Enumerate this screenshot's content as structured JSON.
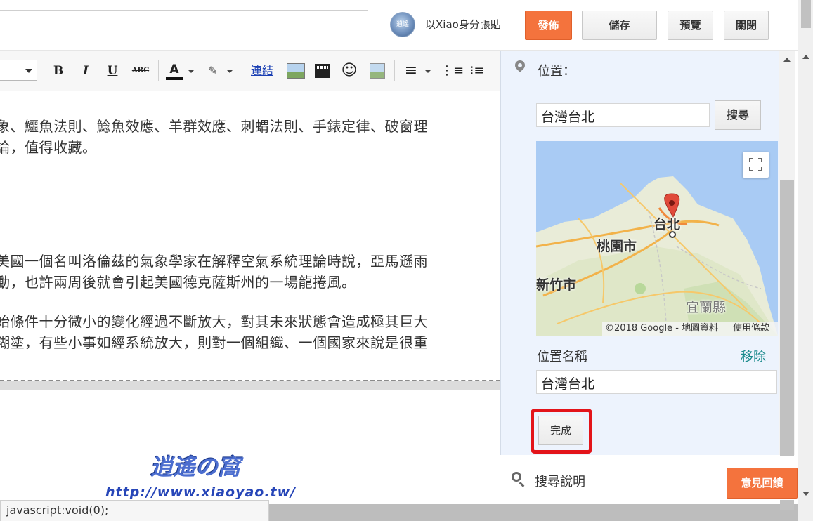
{
  "header": {
    "posting_as": "以Xiao身分張貼",
    "avatar_text": "逍遙",
    "publish_label": "發佈",
    "save_label": "儲存",
    "preview_label": "預覽",
    "close_label": "關閉"
  },
  "toolbar": {
    "bold": "B",
    "italic": "I",
    "underline": "U",
    "strike": "ABC",
    "font_color": "A",
    "link_label": "連結",
    "emoji": "☺",
    "align": "≡",
    "numbered": "⋮≡",
    "bulleted": "⁝≡"
  },
  "editor": {
    "lines": [
      "象、鱷魚法則、鯰魚效應、羊群效應、刺蝟法則、手錶定律、破窗理",
      "論，值得收藏。",
      "美國一個名叫洛倫茲的氣象學家在解釋空氣系統理論時說，亞馬遜雨",
      "動，也許兩周後就會引起美國德克薩斯州的一場龍捲風。",
      "始條件十分微小的變化經過不斷放大，對其未來狀態會造成極其巨大",
      "糊塗，有些小事如經系統放大，則對一個組織、一個國家來說是很重"
    ]
  },
  "watermark": {
    "logo": "逍遙の窩",
    "url": "http://www.xiaoyao.tw/"
  },
  "status": {
    "text": "javascript:void(0);"
  },
  "location_panel": {
    "label": "位置：",
    "search_value": "台灣台北",
    "search_label": "搜尋",
    "map_labels": {
      "taipei": "台北",
      "taoyuan": "桃園市",
      "hsinchu": "新竹市",
      "yilan": "宜蘭縣"
    },
    "map_attribution": "©2018 Google - 地圖資料",
    "map_terms": "使用條款",
    "name_label": "位置名稱",
    "remove_label": "移除",
    "name_value": "台灣台北",
    "done_label": "完成"
  },
  "help": {
    "search_label": "搜尋說明",
    "feedback_label": "意見回饋"
  },
  "colors": {
    "accent_orange": "#f4733d",
    "highlight_red": "#e3141a",
    "panel_bg": "#edf3fd",
    "link_teal": "#1a8a8c"
  }
}
